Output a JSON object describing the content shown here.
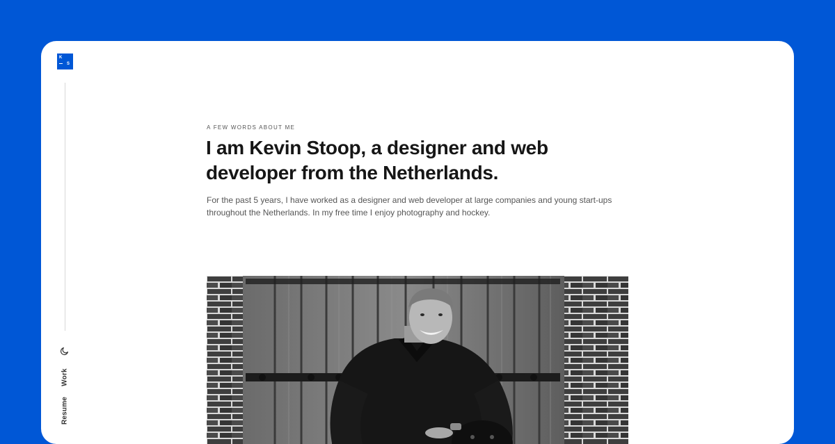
{
  "brand": {
    "letter_top": "K",
    "letter_bottom": "S"
  },
  "sidebar": {
    "theme_toggle_icon": "moon-icon",
    "nav": [
      {
        "label": "Work"
      },
      {
        "label": "Resume"
      }
    ]
  },
  "about": {
    "eyebrow": "A FEW WORDS ABOUT ME",
    "headline": "I am Kevin Stoop, a designer and web developer from the Netherlands.",
    "intro": "For the past 5 years, I have worked as a designer and web developer at large companies and young start-ups throughout the Netherlands. In my free time I enjoy photography and hockey."
  },
  "photo": {
    "subject": "black-and-white portrait photo"
  },
  "colors": {
    "brand_blue": "#0057d6",
    "card": "#ffffff",
    "headline": "#161616",
    "body_text": "#555555"
  }
}
